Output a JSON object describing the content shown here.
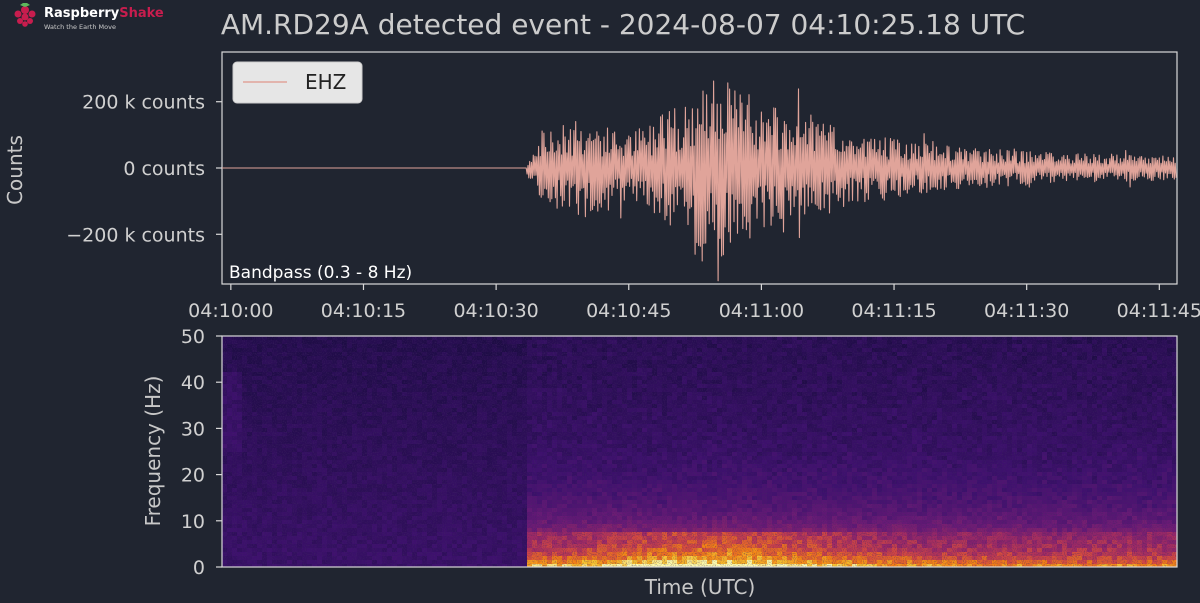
{
  "logo": {
    "brand_first": "Raspberry",
    "brand_second": "Shake",
    "tagline": "Watch the Earth Move"
  },
  "title": "AM.RD29A detected event - 2024-08-07 04:10:25.18 UTC",
  "colors": {
    "background": "#202530",
    "trace": "#e0a49a",
    "axes": "#d9d9d9",
    "text": "#cccccc",
    "logo_red": "#c81d4e"
  },
  "chart_data": [
    {
      "type": "line",
      "ylabel": "Counts",
      "y_tick_labels": [
        "200 k counts",
        "0  counts",
        "−200 k counts"
      ],
      "y_ticks": [
        200000,
        0,
        -200000
      ],
      "ylim": [
        -350000,
        350000
      ],
      "x_tick_labels": [
        "04:10:00",
        "04:10:15",
        "04:10:30",
        "04:10:45",
        "04:11:00",
        "04:11:15",
        "04:11:30",
        "04:11:45"
      ],
      "x_ticks": [
        "04:10:00",
        "04:10:15",
        "04:10:30",
        "04:10:45",
        "04:11:00",
        "04:11:15",
        "04:11:30",
        "04:11:45"
      ],
      "xlim": [
        "04:09:59",
        "04:11:47"
      ],
      "legend": {
        "placement": "top-left",
        "entries": [
          "EHZ"
        ]
      },
      "annotation": "Bandpass (0.3 - 8 Hz)",
      "series": [
        {
          "name": "EHZ",
          "event_onset": "04:10:33.5",
          "samples_per_second": 10,
          "envelope": [
            {
              "t": "04:10:33.5",
              "amp": 20000
            },
            {
              "t": "04:10:35",
              "amp": 110000
            },
            {
              "t": "04:10:40",
              "amp": 150000
            },
            {
              "t": "04:10:45",
              "amp": 110000
            },
            {
              "t": "04:10:50",
              "amp": 180000
            },
            {
              "t": "04:10:55",
              "amp": 280000
            },
            {
              "t": "04:11:00",
              "amp": 200000
            },
            {
              "t": "04:11:05",
              "amp": 170000
            },
            {
              "t": "04:11:10",
              "amp": 110000
            },
            {
              "t": "04:11:20",
              "amp": 70000
            },
            {
              "t": "04:11:30",
              "amp": 50000
            },
            {
              "t": "04:11:47",
              "amp": 35000
            }
          ]
        }
      ]
    },
    {
      "type": "heatmap",
      "ylabel": "Frequency (Hz)",
      "xlabel": "Time (UTC)",
      "y_ticks": [
        0,
        10,
        20,
        30,
        40,
        50
      ],
      "ylim": [
        0,
        50
      ],
      "colormap": "inferno",
      "event_onset": "04:10:33.5",
      "energy_band_hz": [
        0,
        8
      ],
      "peak_time": "04:10:55"
    }
  ]
}
